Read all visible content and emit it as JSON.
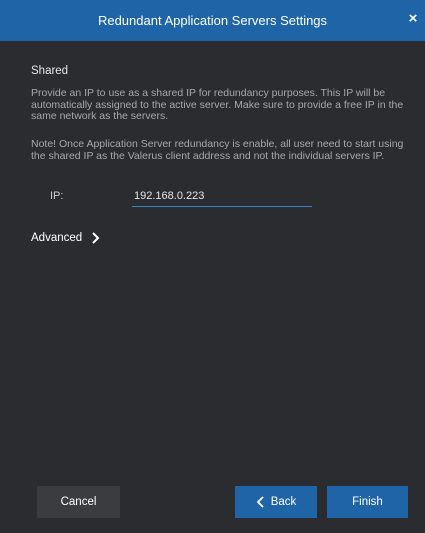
{
  "window": {
    "title": "Redundant Application Servers Settings",
    "close_symbol": "×"
  },
  "shared": {
    "heading": "Shared",
    "description": "Provide an IP to use as a shared IP for redundancy purposes. This IP will be automatically assigned to the active server. Make sure to provide a free IP in the same network as the servers.",
    "note": "Note! Once Application Server redundancy is enable, all user need to start using the shared IP as the Valerus client address and not the individual servers IP.",
    "ip_label": "IP:",
    "ip_value": "192.168.0.223"
  },
  "advanced": {
    "label": "Advanced",
    "icon": "chevron-right-icon"
  },
  "footer": {
    "cancel_label": "Cancel",
    "back_label": "Back",
    "back_icon": "chevron-left-icon",
    "finish_label": "Finish"
  },
  "colors": {
    "background": "#2b2c30",
    "accent": "#1e64a6",
    "cancel_button": "#3b3c40",
    "description_text": "#a7a8ab"
  }
}
